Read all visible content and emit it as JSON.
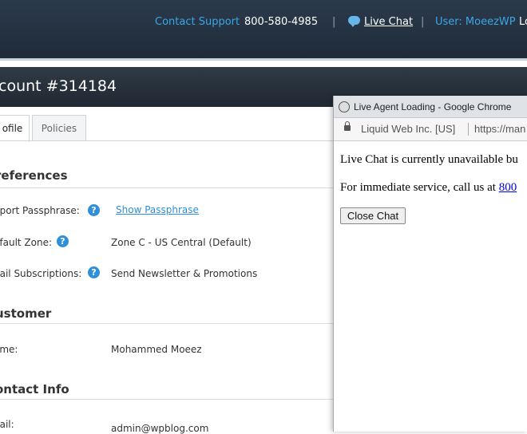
{
  "header": {
    "contact_support_label": "Contact Support",
    "phone": "800-580-4985",
    "separator": "|",
    "live_chat_label": "Live Chat",
    "user_label": "User: MoeezWP",
    "logout_label": "Lo"
  },
  "page": {
    "title": "count #314184"
  },
  "tabs": [
    {
      "label": "ofile",
      "active": true
    },
    {
      "label": "Policies",
      "active": false
    }
  ],
  "preferences": {
    "heading": "references",
    "rows": [
      {
        "label": "pport Passphrase:",
        "value": "Show Passphrase",
        "is_link": true
      },
      {
        "label": "efault Zone:",
        "value": "Zone C - US Central (Default)"
      },
      {
        "label": "nail Subscriptions:",
        "value": "Send Newsletter & Promotions"
      }
    ]
  },
  "customer": {
    "heading": "ustomer",
    "rows": [
      {
        "label": "ame:",
        "value": "Mohammed Moeez"
      }
    ]
  },
  "contact_info": {
    "heading": "ontact Info",
    "rows": [
      {
        "label": "nail:",
        "value": "admin@wpblog.com"
      }
    ]
  },
  "popup": {
    "window_title": "Live Agent Loading - Google Chrome",
    "site_name": "Liquid Web Inc. [US]",
    "url": "https://man",
    "message": "Live Chat is currently unavailable bu",
    "call_text": "For immediate service, call us at ",
    "call_number": "800",
    "close_button": "Close Chat"
  },
  "icons": {
    "help": "question-circle-icon",
    "chat": "chat-bubble-icon",
    "globe": "globe-icon",
    "lock": "lock-icon"
  },
  "colors": {
    "accent": "#39a7e6",
    "link": "#2f8fd8",
    "header_bg": "#243243"
  }
}
